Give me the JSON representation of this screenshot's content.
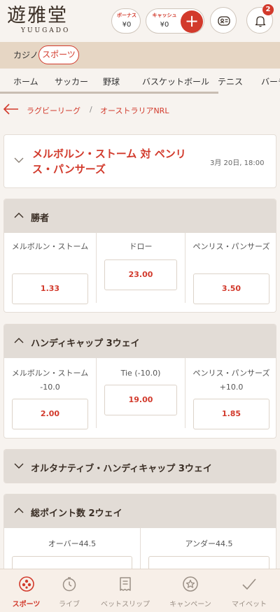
{
  "brand": {
    "name": "遊雅堂",
    "sub": "YUUGADO"
  },
  "wallet": {
    "bonus": {
      "label": "ボーナス",
      "value": "¥0"
    },
    "cash": {
      "label": "キャッシュ",
      "value": "¥0"
    }
  },
  "notifications": {
    "count": "2"
  },
  "categories": {
    "casino": "カジノ",
    "sports": "スポーツ"
  },
  "tabs": [
    "ホーム",
    "サッカー",
    "野球",
    "バスケットボール",
    "テニス",
    "バーチ"
  ],
  "breadcrumb": {
    "items": [
      "ラグビーリーグ",
      "オーストラリアNRL"
    ],
    "separator": "/"
  },
  "match": {
    "title": "メルボルン・ストーム 対 ペンリス・パンサーズ",
    "date": "3月 20日, 18:00"
  },
  "markets": [
    {
      "title": "勝者",
      "selections": [
        {
          "name": "メルボルン・ストーム",
          "odds": "1.33"
        },
        {
          "name": "ドロー",
          "odds": "23.00"
        },
        {
          "name": "ペンリス・パンサーズ",
          "odds": "3.50"
        }
      ]
    },
    {
      "title": "ハンディキャップ 3ウェイ",
      "selections": [
        {
          "name": "メルボルン・ストーム -10.0",
          "odds": "2.00"
        },
        {
          "name": "Tie (-10.0)",
          "odds": "19.00"
        },
        {
          "name": "ペンリス・パンサーズ +10.0",
          "odds": "1.85"
        }
      ]
    },
    {
      "title": "オルタナティブ・ハンディキャップ 3ウェイ"
    },
    {
      "title": "総ポイント数 2ウェイ",
      "selections": [
        {
          "name": "オーバー44.5"
        },
        {
          "name": "アンダー44.5"
        }
      ]
    }
  ],
  "bottom_nav": [
    "スポーツ",
    "ライブ",
    "ベットスリップ",
    "キャンペーン",
    "マイベット"
  ],
  "colors": {
    "accent": "#d23a2c",
    "category_bar": "#e6d6c4",
    "market_header": "#e2dcd6"
  }
}
